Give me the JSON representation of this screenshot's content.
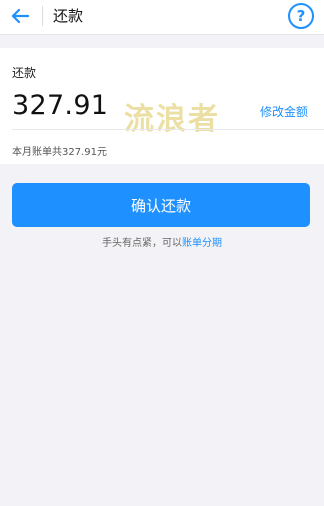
{
  "header": {
    "title": "还款",
    "back_icon": "arrow-left-icon",
    "help_icon": "question-circle-icon",
    "help_glyph": "?"
  },
  "repayment": {
    "label": "还款",
    "amount": "327.91",
    "edit_link": "修改金额",
    "bill_total": "本月账单共327.91元"
  },
  "watermark": "流浪者",
  "actions": {
    "confirm_label": "确认还款"
  },
  "hint": {
    "text": "手头有点紧，可以",
    "link": "账单分期"
  },
  "colors": {
    "accent": "#1e90ff",
    "background": "#f3f3f7",
    "watermark": "#e9dc9a"
  }
}
